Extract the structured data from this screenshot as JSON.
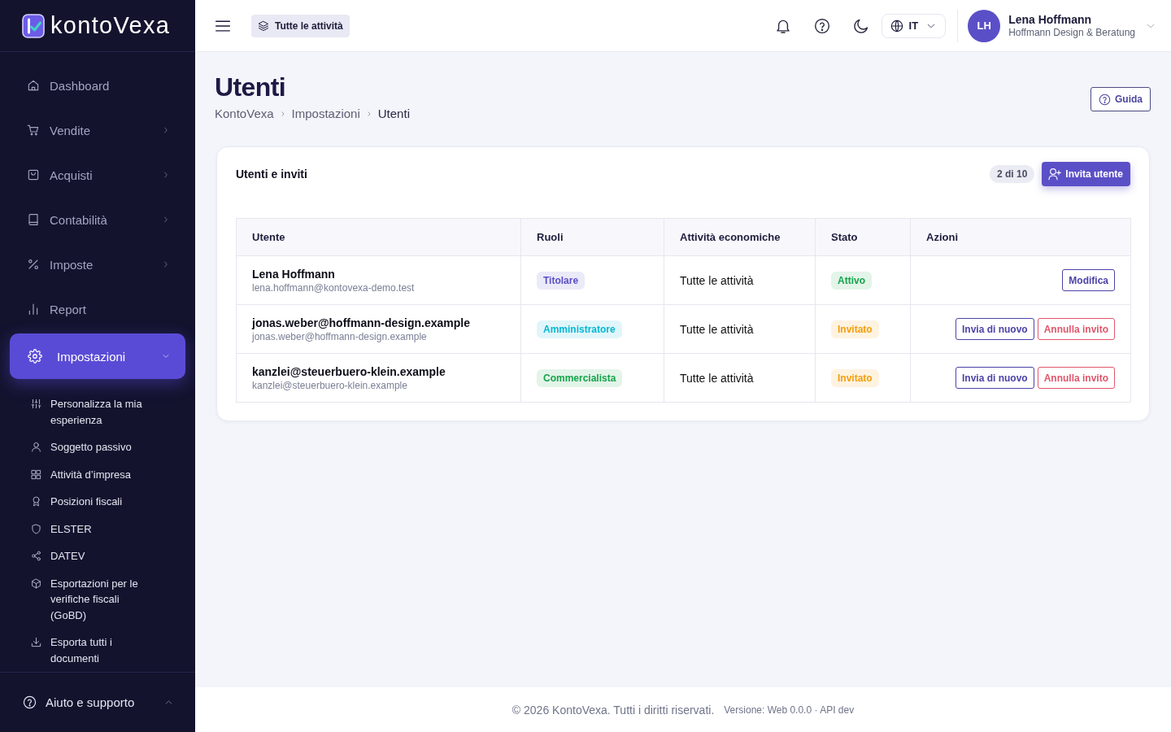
{
  "sidebar": {
    "logo": "kontoVexa",
    "items": [
      {
        "label": "Dashboard",
        "kind": "link",
        "selected": false
      },
      {
        "label": "Vendite",
        "kind": "group",
        "expanded": false,
        "selected": false
      },
      {
        "label": "Acquisti",
        "kind": "group",
        "expanded": false,
        "selected": false
      },
      {
        "label": "Contabilità",
        "kind": "group",
        "expanded": false,
        "selected": false
      },
      {
        "label": "Imposte",
        "kind": "group",
        "expanded": false,
        "selected": false
      },
      {
        "label": "Report",
        "kind": "link",
        "selected": false
      },
      {
        "label": "Impostazioni",
        "kind": "group",
        "expanded": true,
        "selected": true,
        "children": [
          {
            "label": "Personalizza la mia esperienza",
            "selected": false
          },
          {
            "label": "Soggetto passivo",
            "selected": false
          },
          {
            "label": "Attività d’impresa",
            "selected": false
          },
          {
            "label": "Posizioni fiscali",
            "selected": false
          },
          {
            "label": "ELSTER",
            "selected": false
          },
          {
            "label": "DATEV",
            "selected": false
          },
          {
            "label": "Esportazioni per le verifiche fiscali (GoBD)",
            "selected": false
          },
          {
            "label": "Esporta tutti i documenti",
            "selected": false
          }
        ]
      }
    ],
    "help": {
      "label": "Aiuto e supporto"
    }
  },
  "topbar": {
    "scope_button": "Tutte le attività",
    "language": "IT",
    "user": {
      "initials": "LH",
      "name": "Lena Hoffmann",
      "company": "Hoffmann Design & Beratung"
    }
  },
  "page": {
    "title": "Utenti",
    "breadcrumb": [
      "KontoVexa",
      "Impostazioni",
      "Utenti"
    ],
    "help_button": "Guida"
  },
  "card": {
    "title": "Utenti e inviti",
    "count": "2 di 10",
    "invite_button": "Invita utente",
    "table": {
      "columns": [
        "Utente",
        "Ruoli",
        "Attività economiche",
        "Stato",
        "Azioni"
      ],
      "rows": [
        {
          "name": "Lena Hoffmann",
          "email": "lena.hoffmann@kontovexa-demo.test",
          "role": {
            "label": "Titolare",
            "color": "#5b4fc7"
          },
          "activities": "Tutte le attività",
          "status": {
            "label": "Attivo",
            "color": "#16a34a"
          },
          "actions": [
            {
              "label": "Modifica",
              "kind": "default"
            }
          ]
        },
        {
          "name": "jonas.weber@hoffmann-design.example",
          "email": "jonas.weber@hoffmann-design.example",
          "role": {
            "label": "Amministratore",
            "color": "#06b6d4"
          },
          "activities": "Tutte le attività",
          "status": {
            "label": "Invitato",
            "color": "#f59e0b"
          },
          "actions": [
            {
              "label": "Invia di nuovo",
              "kind": "default"
            },
            {
              "label": "Annulla invito",
              "kind": "danger"
            }
          ]
        },
        {
          "name": "kanzlei@steuerbuero-klein.example",
          "email": "kanzlei@steuerbuero-klein.example",
          "role": {
            "label": "Commercialista",
            "color": "#16a34a"
          },
          "activities": "Tutte le attività",
          "status": {
            "label": "Invitato",
            "color": "#f59e0b"
          },
          "actions": [
            {
              "label": "Invia di nuovo",
              "kind": "default"
            },
            {
              "label": "Annulla invito",
              "kind": "danger"
            }
          ]
        }
      ]
    }
  },
  "footer": {
    "copyright": "© 2026 KontoVexa. Tutti i diritti riservati.",
    "version": "Versione: Web 0.0.0 · API dev"
  }
}
